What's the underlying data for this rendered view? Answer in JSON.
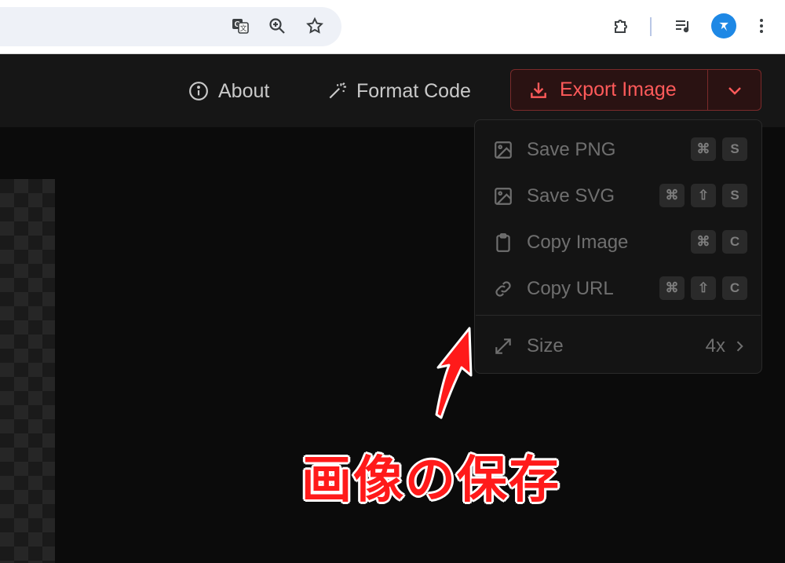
{
  "browser": {
    "icons": [
      "translate-icon",
      "zoom-icon",
      "bookmark-star-icon",
      "extensions-icon",
      "media-queue-icon",
      "profile-avatar-icon",
      "more-menu-icon"
    ]
  },
  "header": {
    "about_label": "About",
    "format_label": "Format Code",
    "export_label": "Export Image",
    "accent_color": "#ff5a5a"
  },
  "menu": {
    "items": [
      {
        "label": "Save PNG",
        "keys": [
          "⌘",
          "S"
        ]
      },
      {
        "label": "Save SVG",
        "keys": [
          "⌘",
          "⇧",
          "S"
        ]
      },
      {
        "label": "Copy Image",
        "keys": [
          "⌘",
          "C"
        ]
      },
      {
        "label": "Copy URL",
        "keys": [
          "⌘",
          "⇧",
          "C"
        ]
      }
    ],
    "size_label": "Size",
    "size_value": "4x"
  },
  "annotation": {
    "text": "画像の保存",
    "color": "#ff1a1a"
  }
}
